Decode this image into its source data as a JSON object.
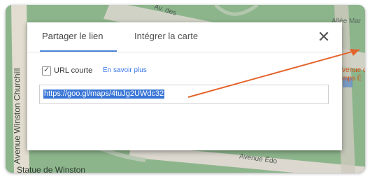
{
  "map": {
    "street_top": "Av. des",
    "street_right": "Allée Mar",
    "street_left": "Avenue Winston Churchill",
    "street_bottom": "Avenue Édo",
    "place_bottom_left": "Statue de Winston",
    "place_right": "venue d\nmps É"
  },
  "dialog": {
    "tab_share": "Partager le lien",
    "tab_embed": "Intégrer la carte",
    "close_symbol": "✕",
    "short_url_label": "URL courte",
    "learn_more": "En savoir plus",
    "url_value": "https://goo.gl/maps/4tuJg2UWdc32",
    "short_url_checked": true
  },
  "colors": {
    "tab_accent": "#4a84d9",
    "selection": "#3a76d6",
    "link": "#3b78e7",
    "annotation_arrow": "#e3652c"
  }
}
